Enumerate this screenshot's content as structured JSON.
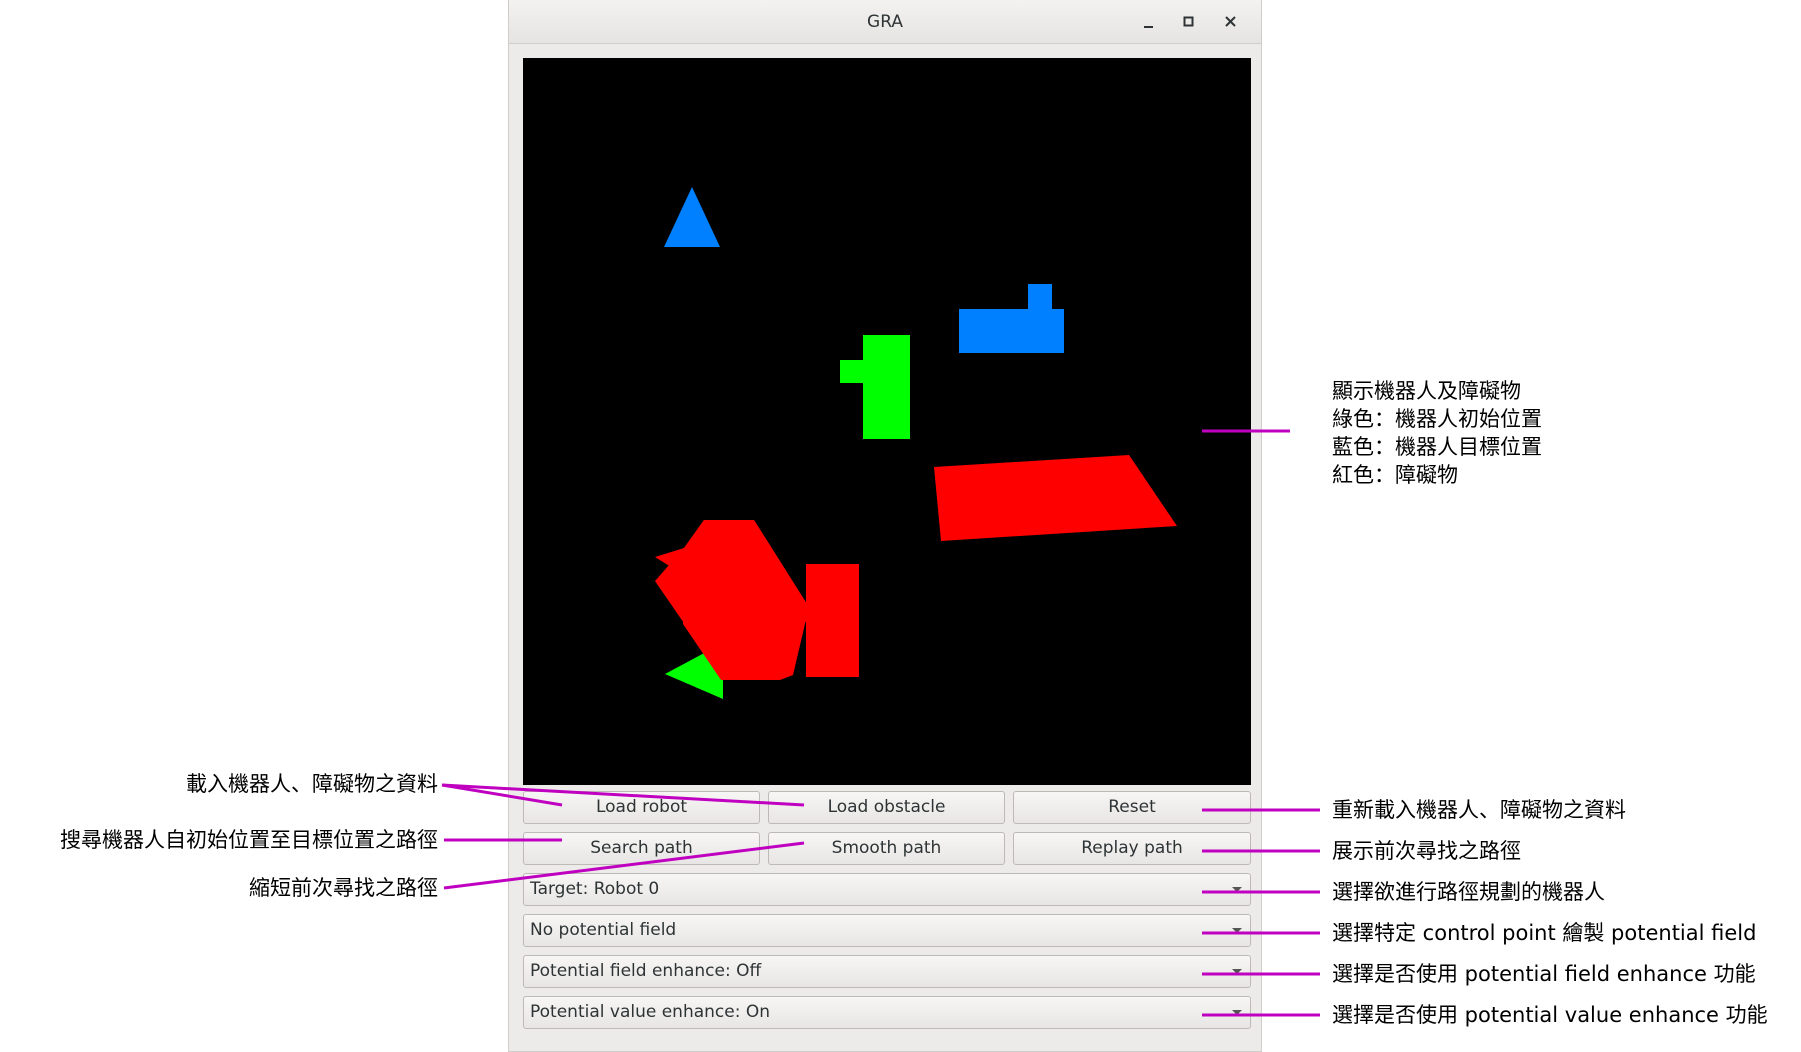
{
  "window": {
    "title": "GRA"
  },
  "colors": {
    "robot_initial": "#00ff00",
    "robot_goal": "#0080ff",
    "obstacle": "#ff0000",
    "canvas_bg": "#000000",
    "annotation_line": "#c000c0"
  },
  "icons": {
    "minimize": "minimize-icon",
    "maximize": "maximize-icon",
    "close": "close-icon",
    "combo_arrow": "chevron-down-icon"
  },
  "buttons": {
    "load_robot": "Load robot",
    "load_obstacle": "Load obstacle",
    "reset": "Reset",
    "search_path": "Search path",
    "smooth_path": "Smooth path",
    "replay_path": "Replay path"
  },
  "combos": {
    "target": "Target: Robot 0",
    "potential_field": "No potential field",
    "field_enhance": "Potential field enhance: Off",
    "value_enhance": "Potential value enhance: On"
  },
  "annotations": {
    "canvas": [
      "顯示機器人及障礙物",
      "綠色：機器人初始位置",
      "藍色：機器人目標位置",
      "紅色：障礙物"
    ],
    "load": "載入機器人、障礙物之資料",
    "search": "搜尋機器人自初始位置至目標位置之路徑",
    "smooth": "縮短前次尋找之路徑",
    "reset": "重新載入機器人、障礙物之資料",
    "replay": "展示前次尋找之路徑",
    "target": "選擇欲進行路徑規劃的機器人",
    "potential_field": "選擇特定 control point 繪製 potential field",
    "field_enhance": "選擇是否使用 potential field enhance 功能",
    "value_enhance": "選擇是否使用 potential value enhance 功能"
  }
}
